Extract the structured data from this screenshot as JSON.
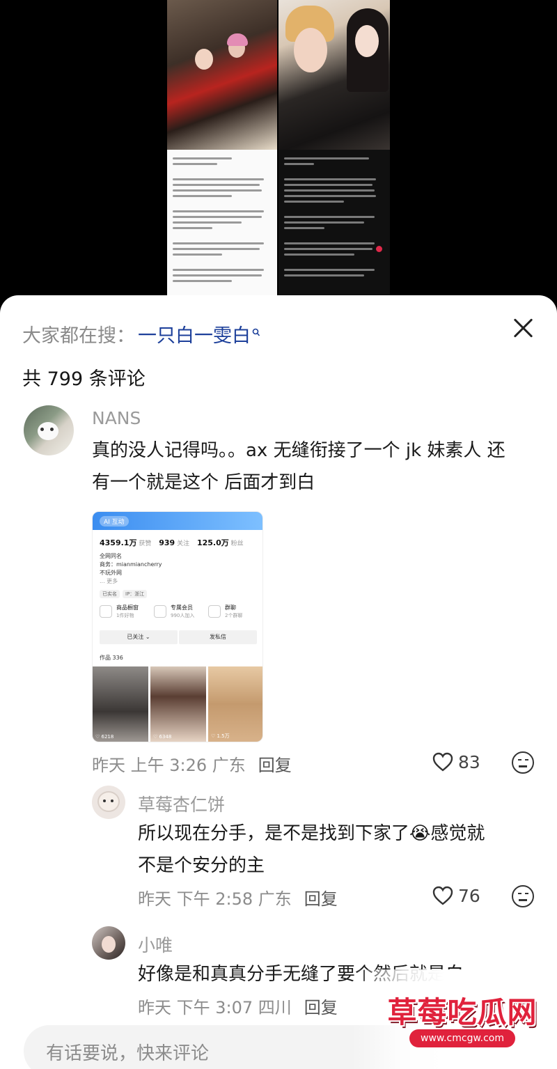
{
  "header": {
    "search_prefix": "大家都在搜：",
    "search_term": "一只白一雯白",
    "search_term_icon": "search-icon",
    "close_icon": "close-icon"
  },
  "comment_count_label": "共 799 条评论",
  "comments": [
    {
      "username": "NANS",
      "text_line1": "真的没人记得吗。。ax 无缝衔接了一个 jk 妹素人 还",
      "text_line2": "有一个就是这个 后面才到白",
      "time": "昨天 上午 3:26 广东",
      "reply_label": "回复",
      "likes": "83",
      "embedded_profile": {
        "badge": "AI 互动",
        "likes_num": "4359.1万",
        "likes_label": "获赞",
        "following_num": "939",
        "following_label": "关注",
        "followers_num": "125.0万",
        "followers_label": "粉丝",
        "line1": "全网同名",
        "line2": "商务：mianmiancherry",
        "line3": "不玩外网",
        "line4": "... 更多",
        "tag1": "已实名",
        "tag2": "IP：浙江",
        "feat1_title": "商品橱窗",
        "feat1_sub": "1件好物",
        "feat2_title": "专属会员",
        "feat2_sub": "990人加入",
        "feat3_title": "群聊",
        "feat3_sub": "2个群聊",
        "follow_btn": "已关注 ⌄",
        "message_btn": "发私信",
        "works_label": "作品 336",
        "thumb1_count": "♡ 6218",
        "thumb2_count": "♡ 6348",
        "thumb3_count": "♡ 1.5万"
      }
    },
    {
      "username": "草莓杏仁饼",
      "text_line1": "所以现在分手，是不是找到下家了😭感觉就",
      "text_line2": "不是个安分的主",
      "time": "昨天 下午 2:58 广东",
      "reply_label": "回复",
      "likes": "76"
    },
    {
      "username": "小唯",
      "text_line1": "好像是和真真分手无缝了要个然后就是白",
      "time": "昨天 下午 3:07 四川",
      "reply_label": "回复"
    }
  ],
  "input": {
    "placeholder": "有话要说，快来评论"
  },
  "watermark": {
    "title": "草莓吃瓜网",
    "url": "www.cmcgw.com"
  },
  "colors": {
    "search_term": "#1c3f9a",
    "watermark": "#e0223c"
  }
}
